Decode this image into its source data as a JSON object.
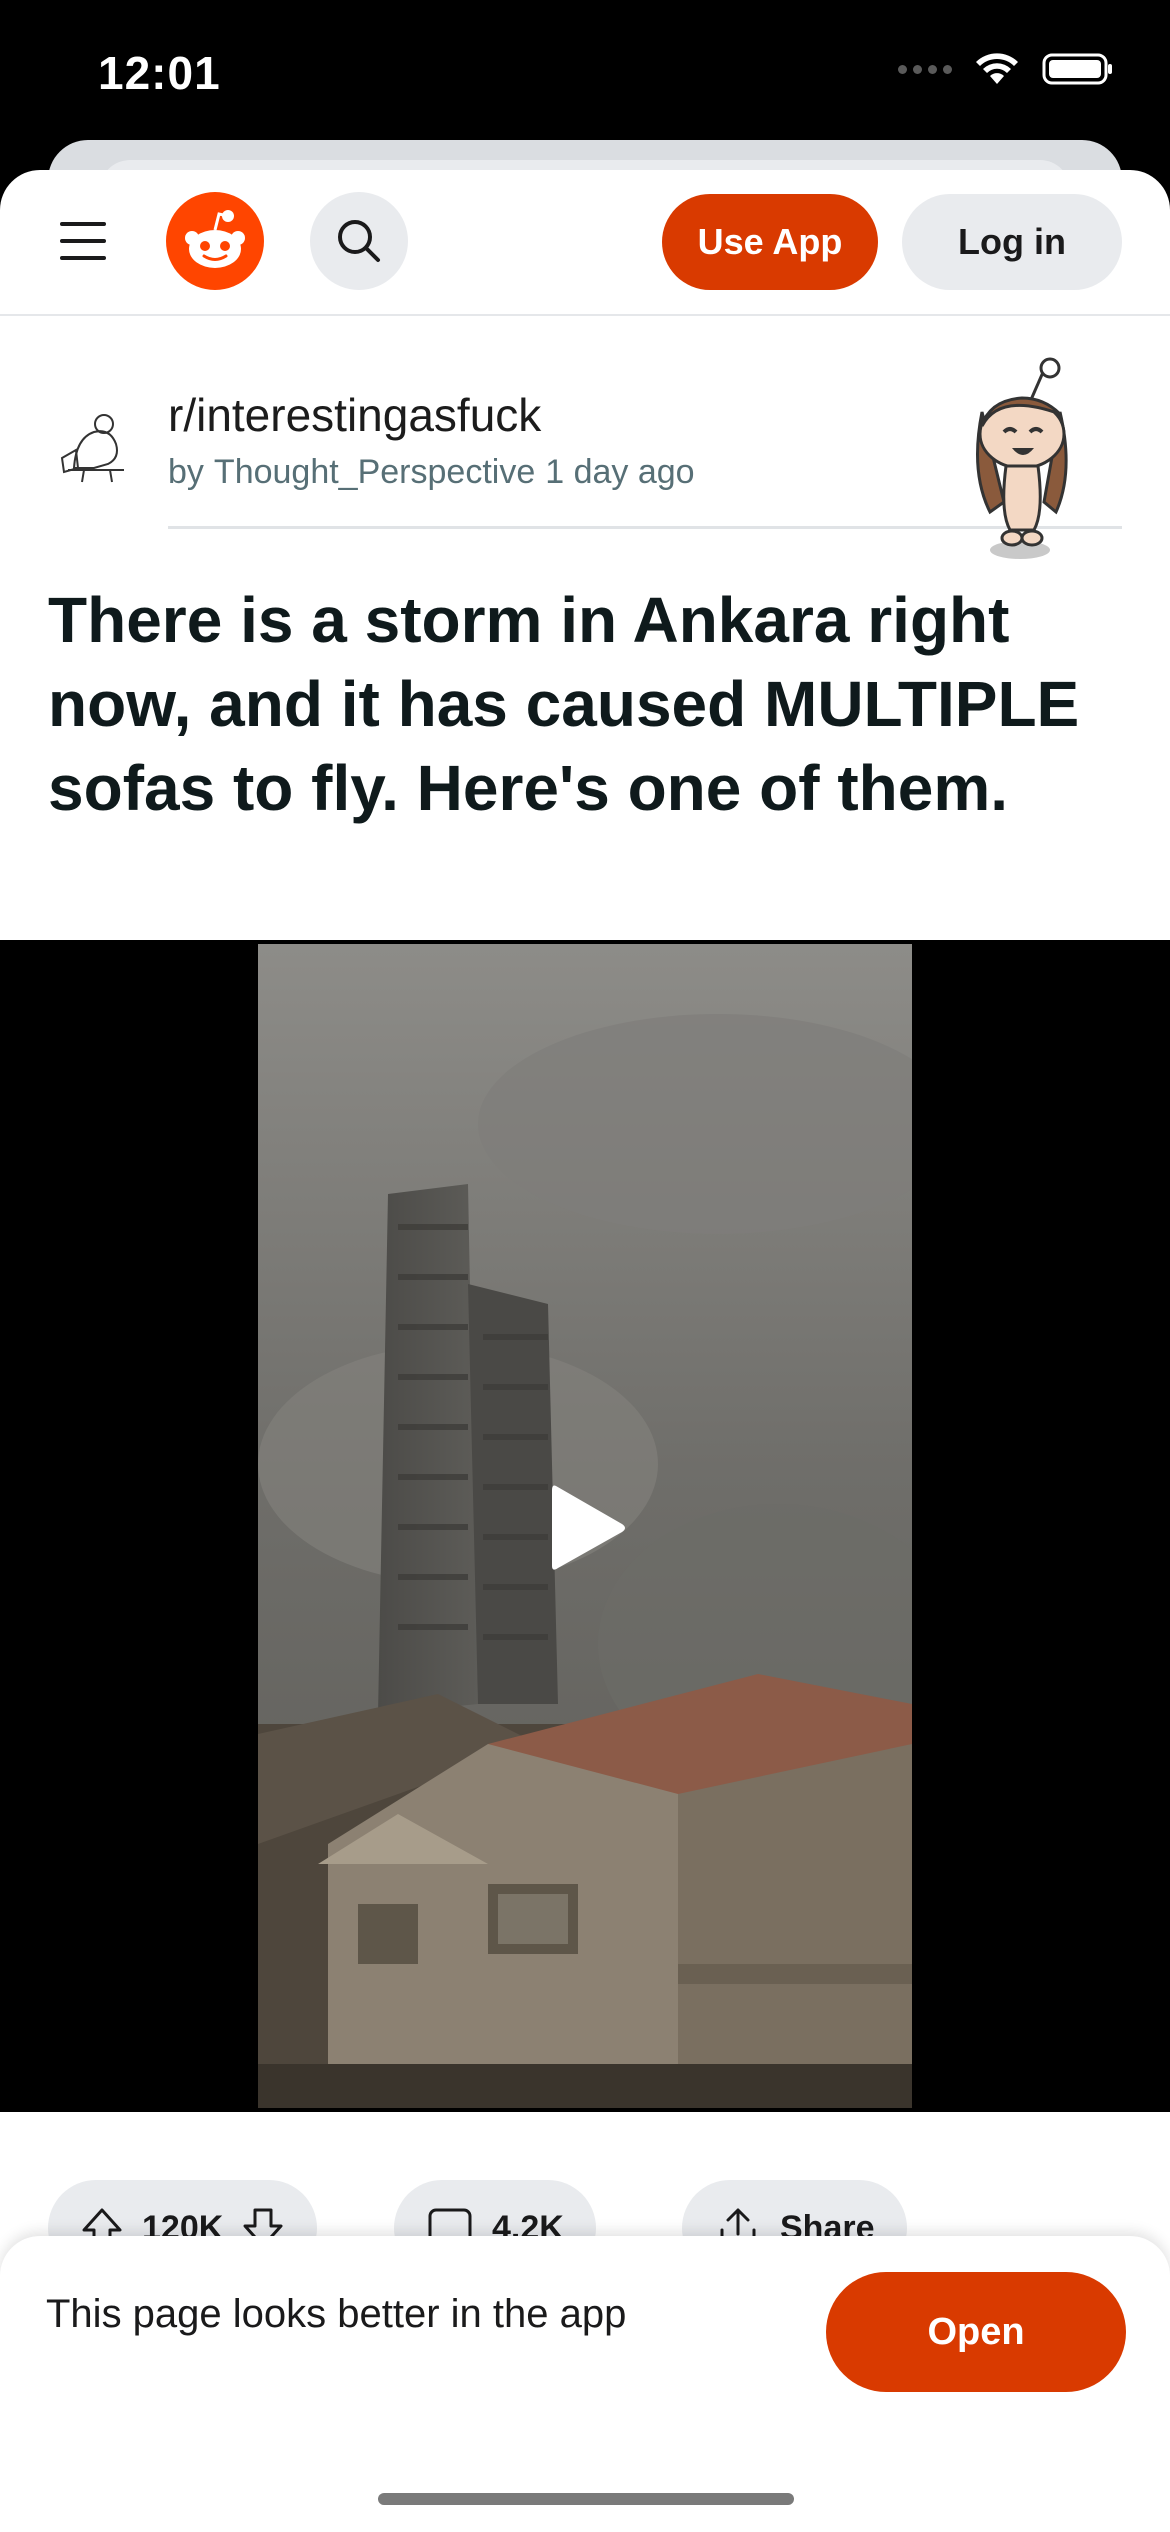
{
  "status_bar": {
    "time": "12:01"
  },
  "header": {
    "menu_icon": "hamburger-icon",
    "logo_icon": "reddit-logo-icon",
    "search_icon": "search-icon",
    "use_app_label": "Use App",
    "login_label": "Log in"
  },
  "post": {
    "subreddit": "r/interestingasfuck",
    "by_label": "by",
    "author": "Thought_Perspective",
    "time_ago": "1 day ago",
    "title": "There is a storm in Ankara right now, and it has caused MULTIPLE sofas to fly. Here's one of them."
  },
  "actions": {
    "upvotes": "120K",
    "comments": "4.2K",
    "share_label": "Share"
  },
  "app_banner": {
    "text": "This page looks better in the app",
    "open_label": "Open"
  },
  "colors": {
    "brand": "#ff4500",
    "button_orange": "#d93a00",
    "pill_gray": "#e9ebee"
  }
}
